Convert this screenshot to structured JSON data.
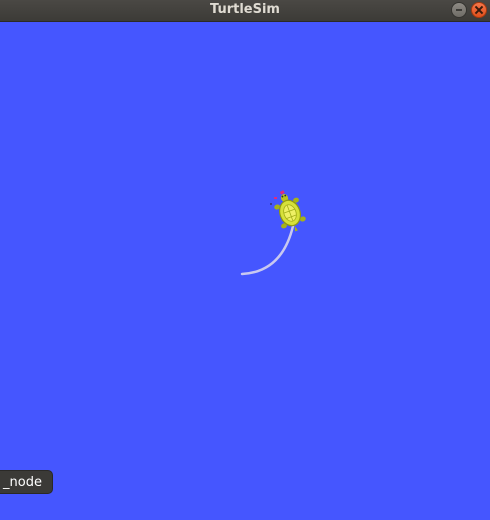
{
  "window": {
    "title": "TurtleSim"
  },
  "canvas": {
    "background_color": "#4556ff",
    "trail_color": "#c8c8f0"
  },
  "turtle": {
    "icon": "turtle-icon"
  },
  "tooltip": {
    "text": "_node"
  },
  "icons": {
    "minimize": "minimize-icon",
    "close": "close-icon"
  }
}
